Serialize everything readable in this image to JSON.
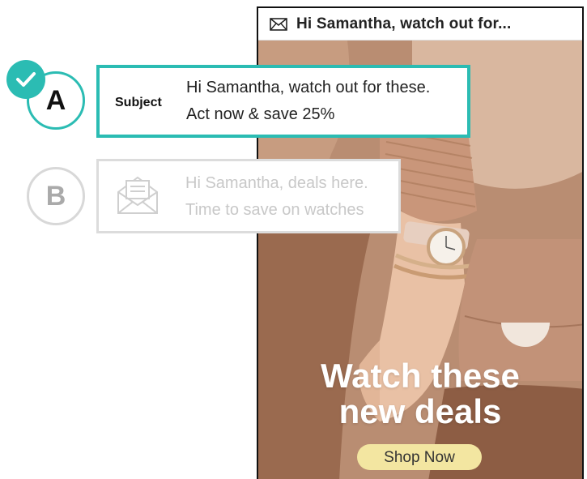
{
  "preview": {
    "header_subject": "Hi Samantha, watch out for...",
    "hero_line1": "Watch these",
    "hero_line2": "new deals",
    "cta_label": "Shop Now"
  },
  "variant_a": {
    "badge": "A",
    "label": "Subject",
    "line1": "Hi Samantha, watch out for these.",
    "line2": "Act now & save 25%",
    "selected": true
  },
  "variant_b": {
    "badge": "B",
    "line1": "Hi Samantha, deals here.",
    "line2": "Time to save on watches",
    "selected": false
  },
  "icons": {
    "header": "envelope-icon",
    "variant_b": "open-envelope-icon",
    "selected": "checkmark-icon"
  },
  "colors": {
    "accent": "#2bbcb3",
    "cta": "#f3e6a1",
    "inactive": "#d8d8d8"
  }
}
